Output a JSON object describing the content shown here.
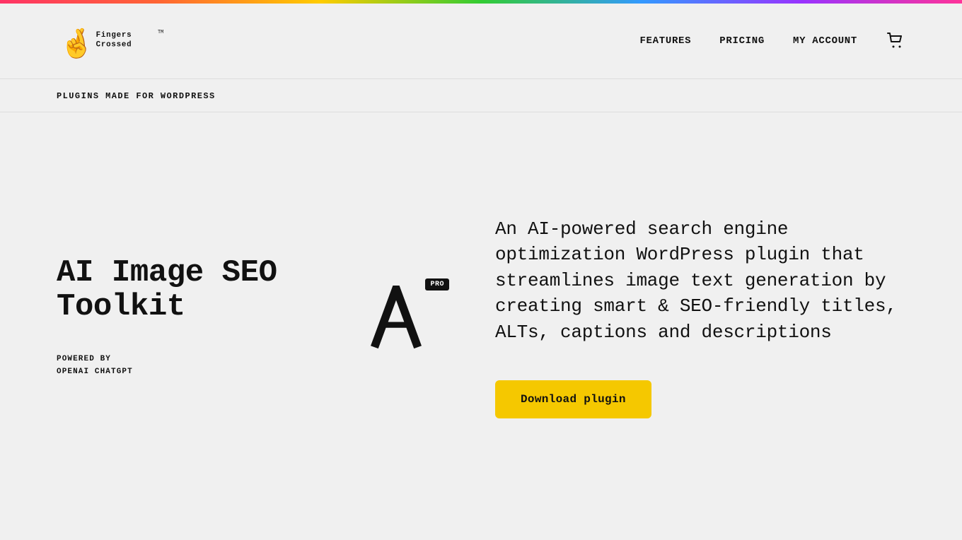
{
  "rainbow_bar": {
    "description": "decorative gradient bar"
  },
  "header": {
    "logo_alt": "Fingers Crossed TM",
    "nav": {
      "features_label": "FEATURES",
      "pricing_label": "PRICING",
      "account_label": "MY ACCOUNT"
    },
    "cart_icon_label": "cart"
  },
  "sub_header": {
    "breadcrumb": "PLUGINS MADE FOR WORDPRESS"
  },
  "main": {
    "plugin_title_line1": "AI Image SEO",
    "plugin_title_line2": "Toolkit",
    "powered_by_line1": "POWERED BY",
    "powered_by_line2": "OPENAI CHATGPT",
    "pro_badge": "PRO",
    "description": "An AI-powered search engine optimization WordPress plugin that streamlines image text generation by creating smart & SEO-friendly titles, ALTs, captions and descriptions",
    "download_button_label": "Download plugin"
  }
}
